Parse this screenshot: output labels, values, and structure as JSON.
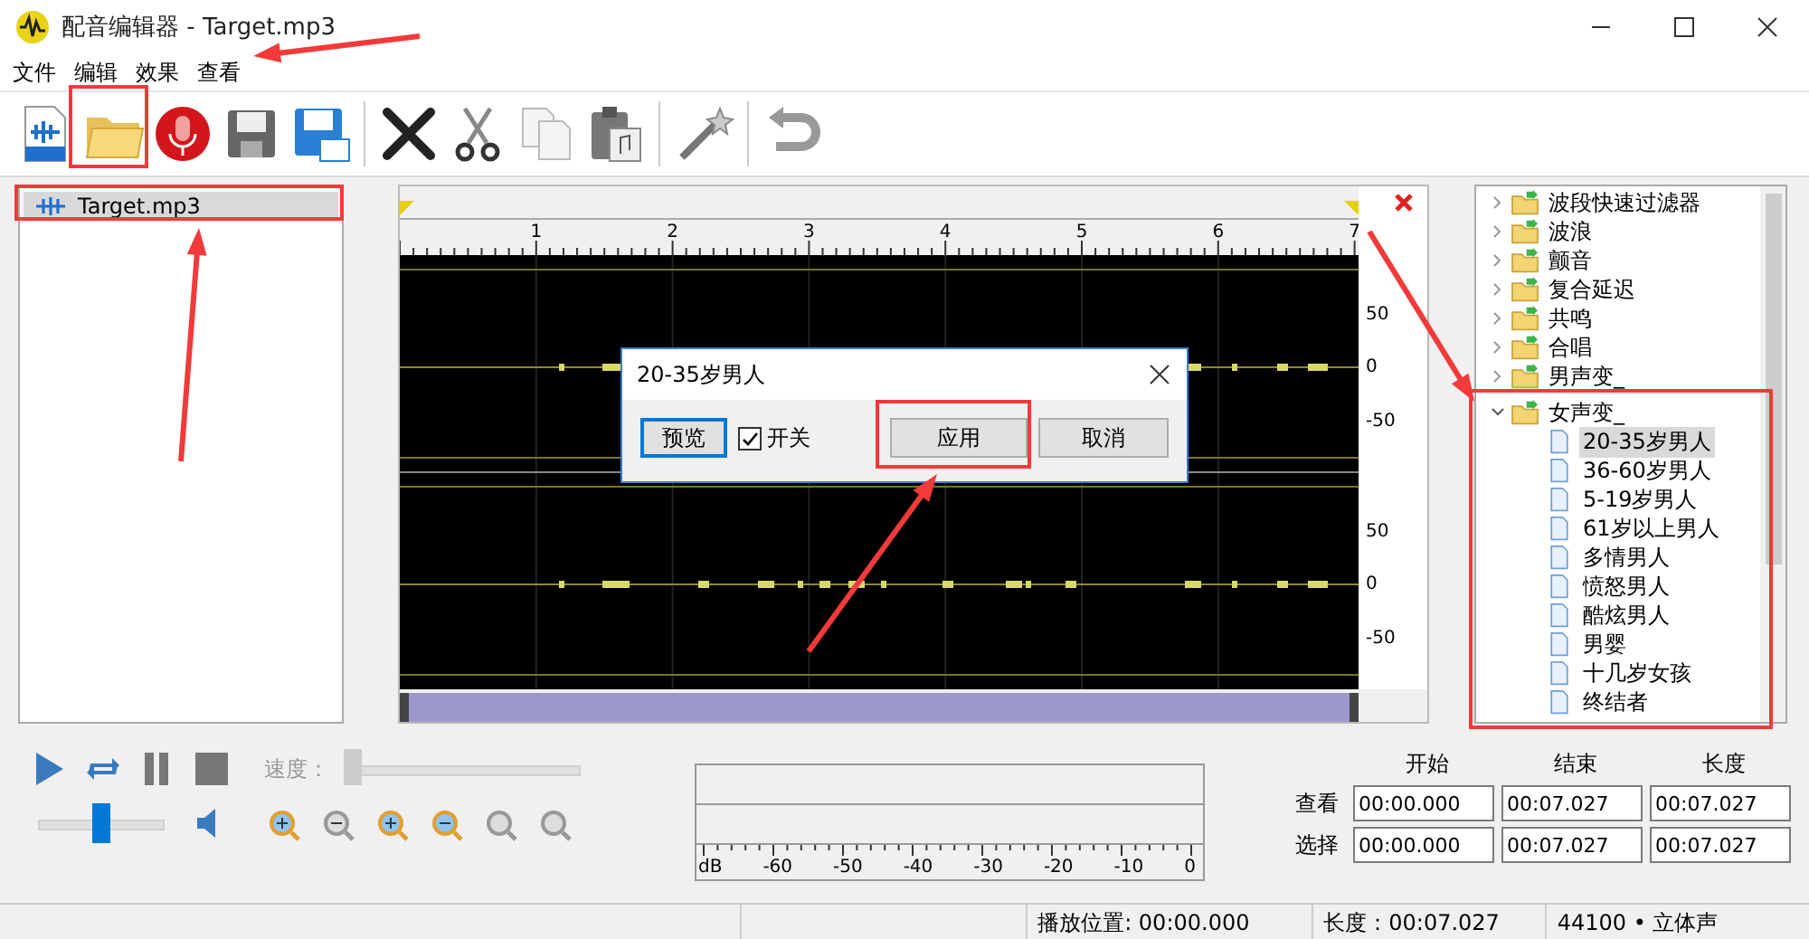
{
  "window": {
    "title": "配音编辑器 - Target.mp3"
  },
  "menu": [
    "文件",
    "编辑",
    "效果",
    "查看"
  ],
  "files": [
    {
      "name": "Target.mp3",
      "selected": true
    }
  ],
  "waveform": {
    "ruler_labels": [
      "1",
      "2",
      "3",
      "4",
      "5",
      "6",
      "7"
    ],
    "channels": [
      {
        "scale": [
          "50",
          "0",
          "-50"
        ]
      },
      {
        "scale": [
          "50",
          "0",
          "-50"
        ]
      }
    ]
  },
  "effects_tree": [
    {
      "label": "波段快速过滤器",
      "expanded": false
    },
    {
      "label": "波浪",
      "expanded": false
    },
    {
      "label": "颤音",
      "expanded": false
    },
    {
      "label": "复合延迟",
      "expanded": false
    },
    {
      "label": "共鸣",
      "expanded": false
    },
    {
      "label": "合唱",
      "expanded": false
    },
    {
      "label": "男声变_",
      "expanded": false
    },
    {
      "label": "女声变_",
      "expanded": true,
      "children": [
        {
          "label": "20-35岁男人",
          "selected": true
        },
        {
          "label": "36-60岁男人",
          "selected": false
        },
        {
          "label": "5-19岁男人",
          "selected": false
        },
        {
          "label": "61岁以上男人",
          "selected": false
        },
        {
          "label": "多情男人",
          "selected": false
        },
        {
          "label": "愤怒男人",
          "selected": false
        },
        {
          "label": "酷炫男人",
          "selected": false
        },
        {
          "label": "男婴",
          "selected": false
        },
        {
          "label": "十几岁女孩",
          "selected": false
        },
        {
          "label": "终结者",
          "selected": false
        }
      ]
    }
  ],
  "dialog": {
    "title": "20-35岁男人",
    "preview_button": "预览",
    "toggle": {
      "label": "开关",
      "checked": true
    },
    "apply_button": "应用",
    "cancel_button": "取消"
  },
  "playback": {
    "speed": {
      "label": "速度：",
      "disabled": true,
      "level": 0
    },
    "volume": {
      "level": 0.5
    }
  },
  "meter": {
    "scale": [
      "dB",
      "-60",
      "-50",
      "-40",
      "-30",
      "-20",
      "-10",
      "0"
    ]
  },
  "times": {
    "columns": [
      "开始",
      "结束",
      "长度"
    ],
    "rows": [
      {
        "label": "查看",
        "values": [
          "00:00.000",
          "00:07.027",
          "00:07.027"
        ]
      },
      {
        "label": "选择",
        "values": [
          "00:00.000",
          "00:07.027",
          "00:07.027"
        ]
      }
    ]
  },
  "status_bar": [
    "播放位置: 00:00.000",
    "长度：00:07.027",
    "44100 • 立体声"
  ]
}
